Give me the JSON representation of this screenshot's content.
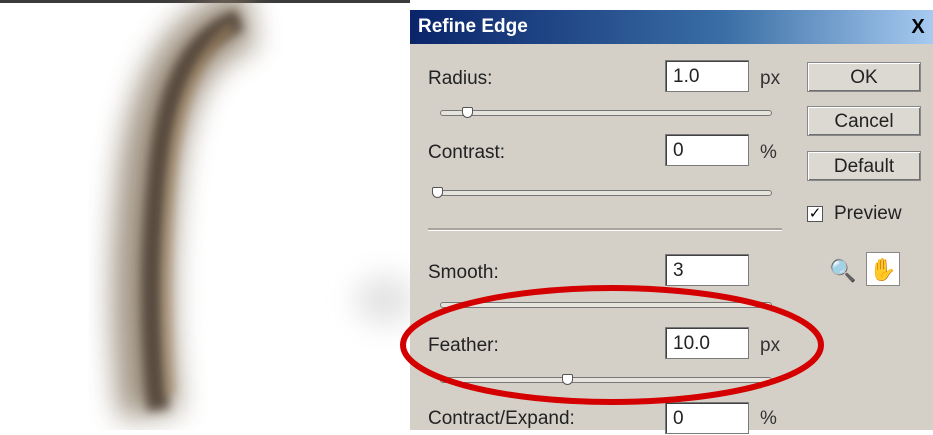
{
  "dialog": {
    "title": "Refine Edge",
    "close_glyph": "X",
    "radius": {
      "label": "Radius:",
      "value": "1.0",
      "unit": "px",
      "slider_fraction": 0.07
    },
    "contrast": {
      "label": "Contrast:",
      "value": "0",
      "unit": "%",
      "slider_fraction": 0.0
    },
    "smooth": {
      "label": "Smooth:",
      "value": "3"
    },
    "feather": {
      "label": "Feather:",
      "value": "10.0",
      "unit": "px",
      "slider_fraction": 0.38
    },
    "contract_expand": {
      "label": "Contract/Expand:",
      "value": "0",
      "unit": "%"
    },
    "buttons": {
      "ok": "OK",
      "cancel": "Cancel",
      "default": "Default"
    },
    "preview": {
      "label": "Preview",
      "checked": true,
      "check_glyph": "✓"
    },
    "tools": {
      "zoom_icon": "zoom-icon",
      "zoom_glyph": "🔍",
      "hand_icon": "hand-icon",
      "hand_glyph": "✋"
    },
    "highlight_color": "#d40000"
  }
}
